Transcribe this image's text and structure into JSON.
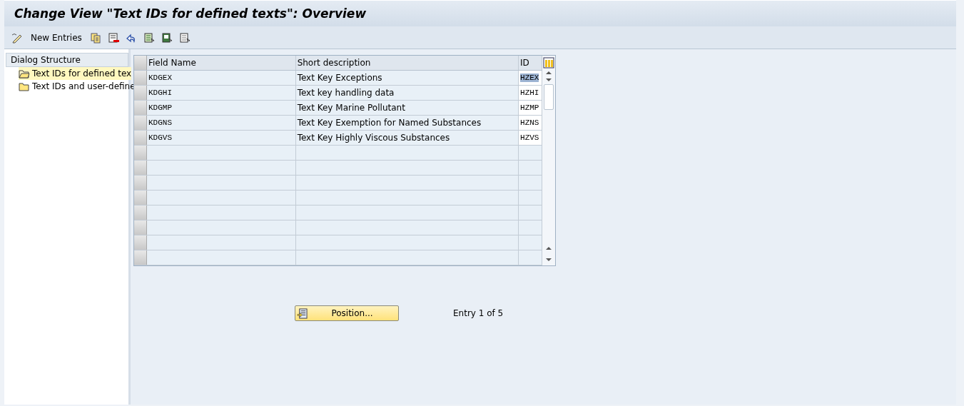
{
  "window": {
    "title": "Change View \"Text IDs for defined texts\": Overview"
  },
  "toolbar": {
    "buttons": [
      {
        "kind": "display-change"
      },
      {
        "kind": "text",
        "label": "New Entries"
      },
      {
        "kind": "copy"
      },
      {
        "kind": "delete"
      },
      {
        "kind": "undo"
      },
      {
        "kind": "select-all"
      },
      {
        "kind": "select-block"
      },
      {
        "kind": "deselect"
      }
    ]
  },
  "dialog_structure": {
    "title": "Dialog Structure",
    "items": [
      {
        "label": "Text IDs for defined tex",
        "selected": true
      },
      {
        "label": "Text IDs and user-define",
        "selected": false
      }
    ]
  },
  "table": {
    "columns": [
      "Field Name",
      "Short description",
      "ID"
    ],
    "rows": [
      {
        "field_name": "KDGEX",
        "short_description": "Text Key Exceptions",
        "id": "HZEX",
        "id_selected": true
      },
      {
        "field_name": "KDGHI",
        "short_description": "Text key handling data",
        "id": "HZHI",
        "id_selected": false
      },
      {
        "field_name": "KDGMP",
        "short_description": "Text Key Marine Pollutant",
        "id": "HZMP",
        "id_selected": false
      },
      {
        "field_name": "KDGNS",
        "short_description": "Text Key Exemption for Named Substances",
        "id": "HZNS",
        "id_selected": false
      },
      {
        "field_name": "KDGVS",
        "short_description": "Text Key Highly Viscous Substances",
        "id": "HZVS",
        "id_selected": false
      }
    ]
  },
  "position_button": {
    "label": "Position..."
  },
  "entry_info": "Entry 1 of 5"
}
